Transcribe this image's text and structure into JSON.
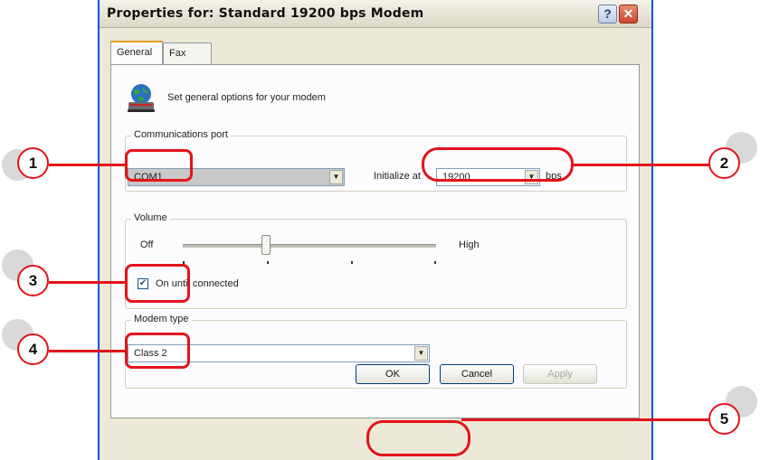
{
  "window": {
    "title": "Properties for: Standard 19200 bps Modem",
    "help_symbol": "?",
    "close_symbol": "✕"
  },
  "tabs": [
    {
      "label": "General",
      "active": true
    },
    {
      "label": "Fax",
      "active": false
    }
  ],
  "general": {
    "description": "Set general options for your modem",
    "comm_port": {
      "legend": "Communications port",
      "value": "COM1",
      "init_label": "Initialize at",
      "baud_value": "19200",
      "baud_unit": "bps"
    },
    "volume": {
      "legend": "Volume",
      "off_label": "Off",
      "high_label": "High",
      "level": 0.33,
      "checkbox_label": "On until connected",
      "checkbox_checked": true
    },
    "modem_type": {
      "legend": "Modem type",
      "value": "Class 2"
    }
  },
  "buttons": {
    "ok": "OK",
    "cancel": "Cancel",
    "apply": "Apply"
  },
  "callouts": [
    "1",
    "2",
    "3",
    "4",
    "5"
  ],
  "colors": {
    "callout_red": "#e3131a",
    "title_blue": "#0054e3"
  },
  "icons": {
    "modem": "modem-globe-icon",
    "dropdown": "▼",
    "check": "✔"
  }
}
